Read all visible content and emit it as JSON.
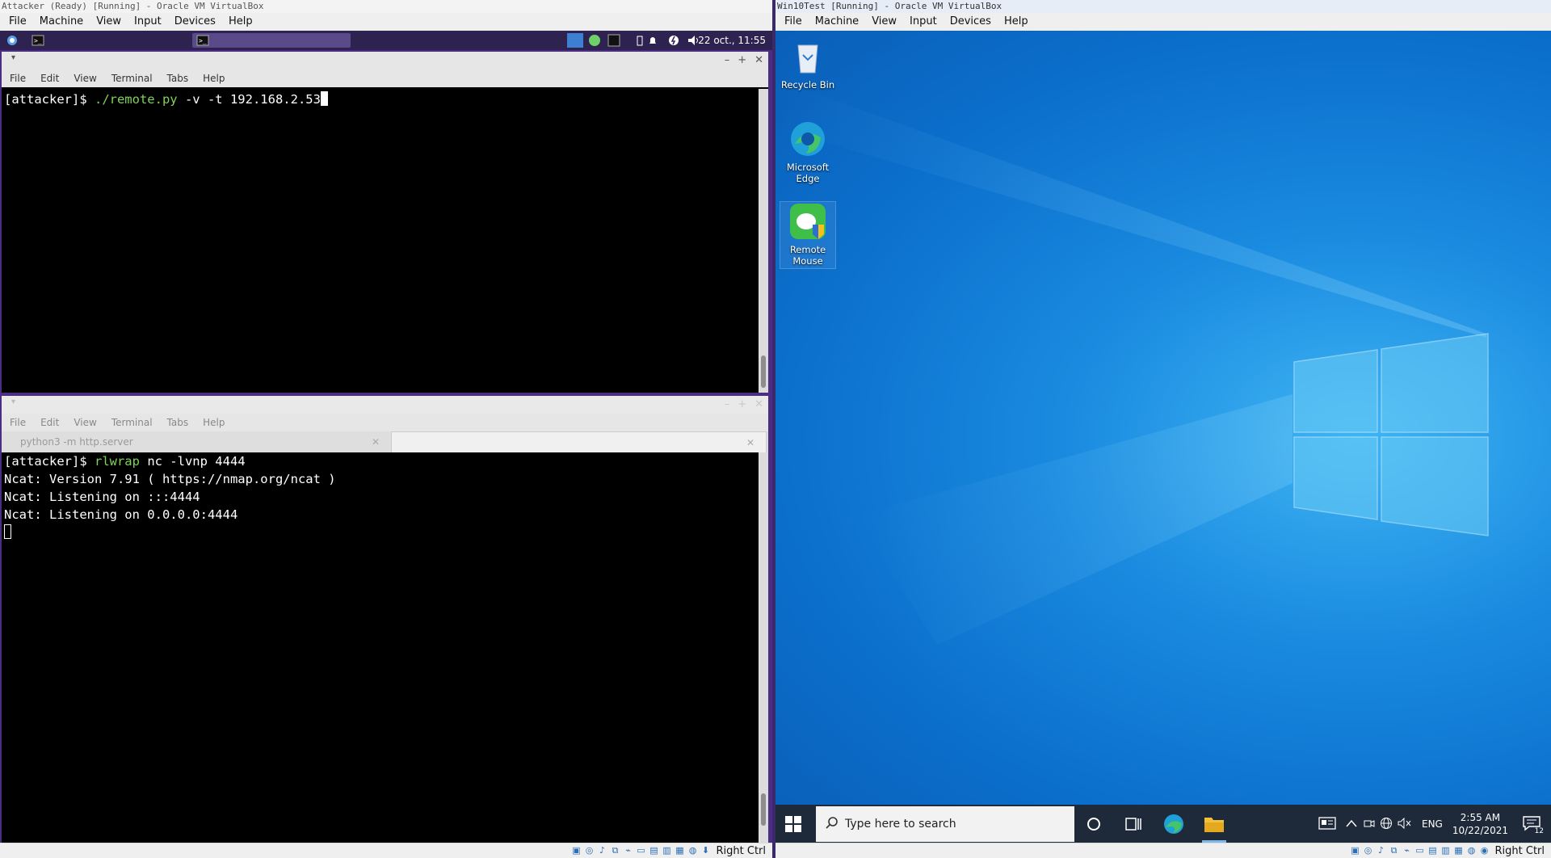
{
  "left_window": {
    "title": "Attacker (Ready) [Running] - Oracle VM VirtualBox",
    "menu": [
      "File",
      "Machine",
      "View",
      "Input",
      "Devices",
      "Help"
    ],
    "host_key": "Right Ctrl"
  },
  "right_window": {
    "title": "Win10Test [Running] - Oracle VM VirtualBox",
    "menu": [
      "File",
      "Machine",
      "View",
      "Input",
      "Devices",
      "Help"
    ],
    "host_key": "Right Ctrl"
  },
  "xfce_panel": {
    "clock": "22 oct., 11:55"
  },
  "terminal_top": {
    "menu": [
      "File",
      "Edit",
      "View",
      "Terminal",
      "Tabs",
      "Help"
    ],
    "prompt": "[attacker]$ ",
    "command": "./remote.py",
    "args": " -v -t 192.168.2.53"
  },
  "terminal_bottom": {
    "menu": [
      "File",
      "Edit",
      "View",
      "Terminal",
      "Tabs",
      "Help"
    ],
    "tabs": [
      {
        "label": "python3 -m http.server"
      },
      {
        "label": ""
      }
    ],
    "prompt": "[attacker]$ ",
    "command": "rlwrap",
    "args": " nc -lvnp 4444",
    "output": [
      "Ncat: Version 7.91 ( https://nmap.org/ncat )",
      "Ncat: Listening on :::4444",
      "Ncat: Listening on 0.0.0.0:4444"
    ]
  },
  "windows_desktop": {
    "icons": [
      {
        "label_line1": "Recycle Bin",
        "label_line2": "",
        "icon": "recycle-bin-icon"
      },
      {
        "label_line1": "Microsoft",
        "label_line2": "Edge",
        "icon": "edge-icon"
      },
      {
        "label_line1": "Remote",
        "label_line2": "Mouse",
        "icon": "remote-mouse-icon"
      }
    ],
    "taskbar": {
      "search_placeholder": "Type here to search",
      "language": "ENG",
      "time": "2:55 AM",
      "date": "10/22/2021",
      "notification_count": "12"
    }
  },
  "colors": {
    "terminal_bg": "#000000",
    "prompt_green": "#7fd35a",
    "xfce_panel": "#2e2250",
    "win_desktop": "#1a8be0",
    "win_taskbar": "#1e2a3a"
  }
}
